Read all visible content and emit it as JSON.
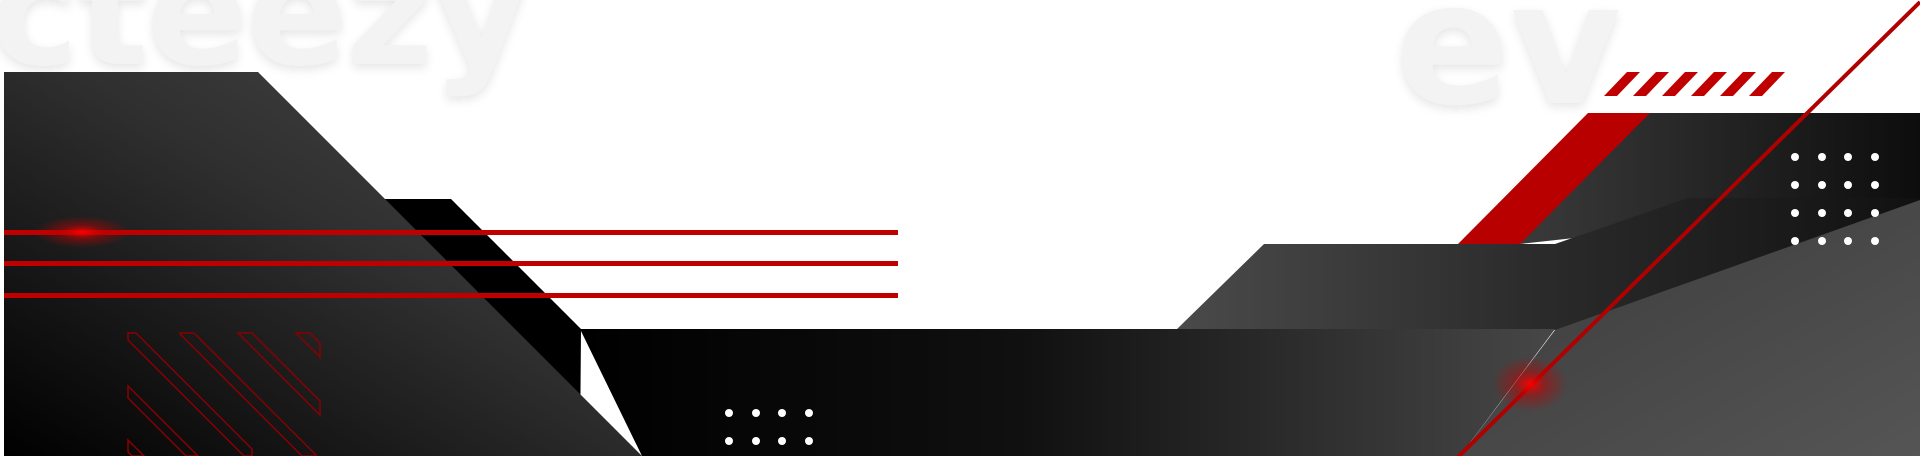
{
  "watermark": {
    "left_text": "cteezy",
    "right_text": "ev"
  },
  "colors": {
    "background": "#ffffff",
    "panel_dark": "#000000",
    "panel_mid": "#2b2b2b",
    "panel_light": "#4a4a4a",
    "accent_red": "#c00000",
    "dot": "#ffffff"
  }
}
